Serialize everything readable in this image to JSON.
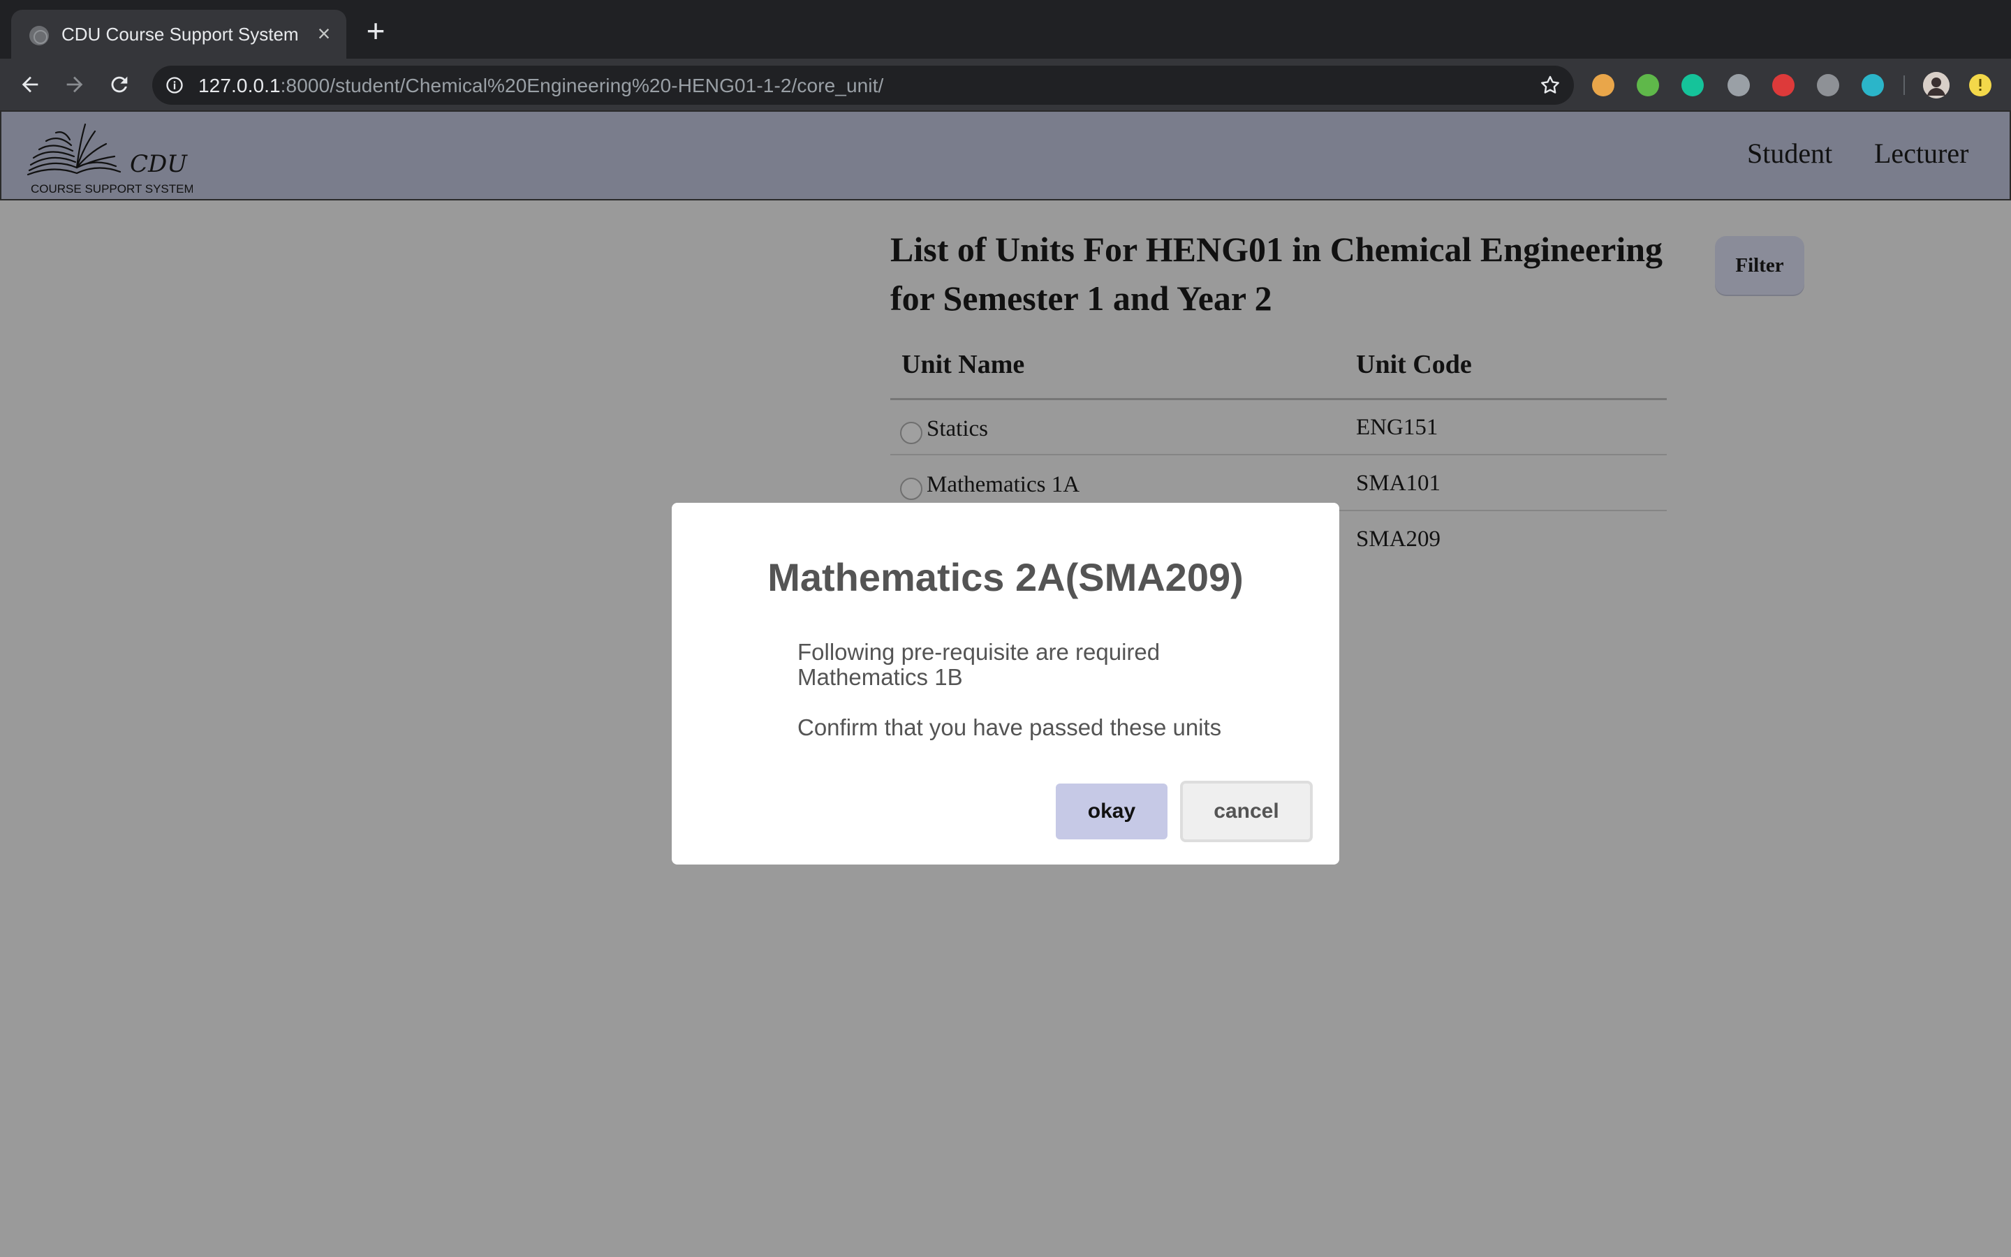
{
  "browser": {
    "tab_title": "CDU Course Support System",
    "url_host": "127.0.0.1",
    "url_rest": ":8000/student/Chemical%20Engineering%20-HENG01-1-2/core_unit/",
    "extensions": [
      {
        "name": "cookie-extension-icon",
        "color": "#e9a64a"
      },
      {
        "name": "checkmark-extension-icon",
        "color": "#5fb84a"
      },
      {
        "name": "grammarly-extension-icon",
        "color": "#15c39a"
      },
      {
        "name": "toolbar-extension-icon",
        "color": "#9aa0a6"
      },
      {
        "name": "angular-extension-icon",
        "color": "#dd3a3a"
      },
      {
        "name": "skype-extension-icon",
        "color": "#8e9196"
      },
      {
        "name": "m-extension-icon",
        "color": "#2bb5c9"
      }
    ],
    "accent_profile": "#f3d84a"
  },
  "site": {
    "logo_text": "CDU",
    "logo_subtext": "COURSE SUPPORT SYSTEM",
    "nav": {
      "student": "Student",
      "lecturer": "Lecturer"
    }
  },
  "main": {
    "title": "List of Units For HENG01 in Chemical Engineering for Semester 1 and Year 2",
    "filter_label": "Filter",
    "table": {
      "headers": [
        "Unit Name",
        "Unit Code"
      ],
      "rows": [
        {
          "name": "Statics",
          "code": "ENG151"
        },
        {
          "name": "Mathematics 1A",
          "code": "SMA101"
        },
        {
          "name": "",
          "code": "SMA209"
        }
      ]
    }
  },
  "modal": {
    "title": "Mathematics 2A(SMA209)",
    "line1": "Following pre-requisite are required",
    "line2": "Mathematics 1B",
    "line3": "Confirm that you have passed these units",
    "okay_label": "okay",
    "cancel_label": "cancel"
  }
}
